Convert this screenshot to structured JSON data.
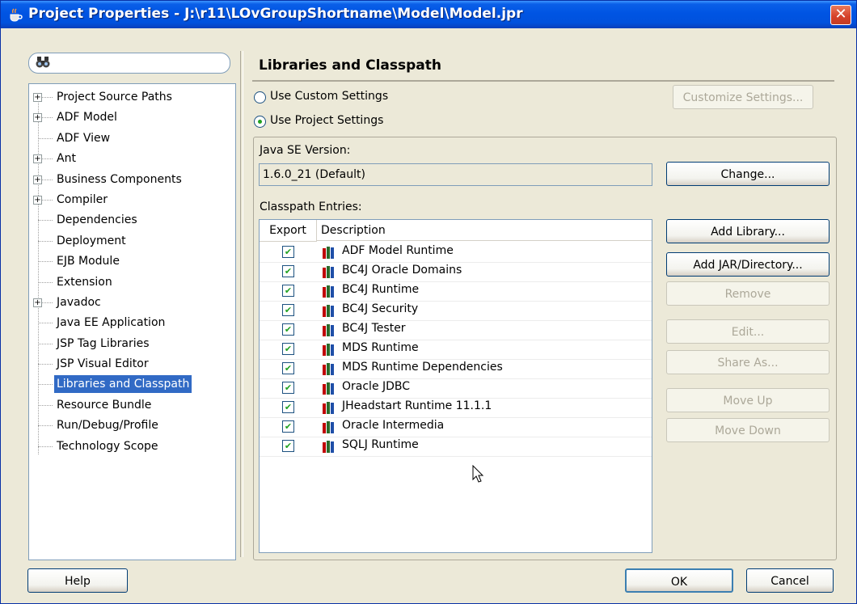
{
  "window": {
    "title": "Project Properties - J:\\r11\\LOvGroupShortname\\Model\\Model.jpr"
  },
  "tree": {
    "items": [
      {
        "label": "Project Source Paths",
        "expandable": true
      },
      {
        "label": "ADF Model",
        "expandable": true
      },
      {
        "label": "ADF View",
        "expandable": false
      },
      {
        "label": "Ant",
        "expandable": true
      },
      {
        "label": "Business Components",
        "expandable": true
      },
      {
        "label": "Compiler",
        "expandable": true
      },
      {
        "label": "Dependencies",
        "expandable": false
      },
      {
        "label": "Deployment",
        "expandable": false
      },
      {
        "label": "EJB Module",
        "expandable": false
      },
      {
        "label": "Extension",
        "expandable": false
      },
      {
        "label": "Javadoc",
        "expandable": true
      },
      {
        "label": "Java EE Application",
        "expandable": false
      },
      {
        "label": "JSP Tag Libraries",
        "expandable": false
      },
      {
        "label": "JSP Visual Editor",
        "expandable": false
      },
      {
        "label": "Libraries and Classpath",
        "expandable": false,
        "selected": true
      },
      {
        "label": "Resource Bundle",
        "expandable": false
      },
      {
        "label": "Run/Debug/Profile",
        "expandable": false
      },
      {
        "label": "Technology Scope",
        "expandable": false
      }
    ]
  },
  "panel": {
    "title": "Libraries and Classpath",
    "radio_custom": "Use Custom Settings",
    "radio_project": "Use Project Settings",
    "customize_button": "Customize Settings...",
    "java_se_label": "Java SE Version:",
    "java_se_value": "1.6.0_21 (Default)",
    "change_button": "Change...",
    "classpath_label": "Classpath Entries:",
    "col_export": "Export",
    "col_description": "Description",
    "entries": [
      "ADF Model Runtime",
      "BC4J Oracle Domains",
      "BC4J Runtime",
      "BC4J Security",
      "BC4J Tester",
      "MDS Runtime",
      "MDS Runtime Dependencies",
      "Oracle JDBC",
      "JHeadstart Runtime 11.1.1",
      "Oracle Intermedia",
      "SQLJ Runtime"
    ],
    "buttons": {
      "add_library": "Add Library...",
      "add_jar": "Add JAR/Directory...",
      "remove": "Remove",
      "edit": "Edit...",
      "share_as": "Share As...",
      "move_up": "Move Up",
      "move_down": "Move Down"
    }
  },
  "footer": {
    "help": "Help",
    "ok": "OK",
    "cancel": "Cancel"
  }
}
